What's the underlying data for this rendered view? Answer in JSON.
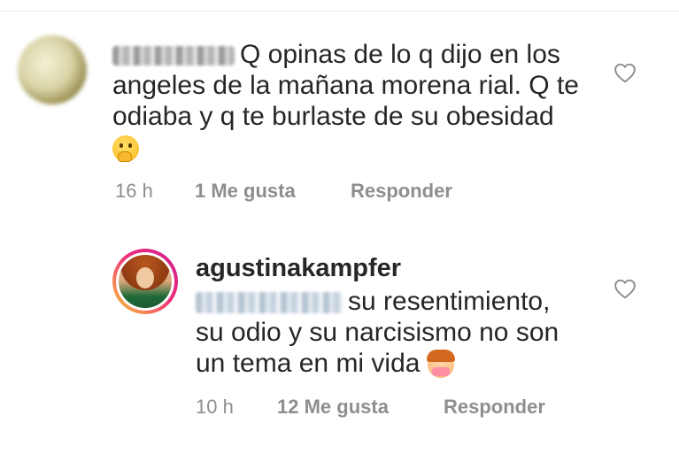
{
  "comment": {
    "text_line1": "Q opinas de lo q dijo en los",
    "text_line2": "angeles de la mañana morena rial. Q te",
    "text_line3": "odiaba y q te burlaste de su obesidad",
    "emoji": "thinking-face-emoji",
    "time": "16 h",
    "likes": "1 Me gusta",
    "reply": "Responder"
  },
  "reply": {
    "username": "agustinakampfer",
    "text_line1": "su resentimiento,",
    "text_line2": "su odio y su narcisismo no son",
    "text_line3": "un tema en mi vida",
    "emoji": "woman-gesturing-no-emoji",
    "time": "10 h",
    "likes": "12 Me gusta",
    "reply": "Responder"
  },
  "icons": {
    "like": "heart-outline-icon"
  },
  "colors": {
    "text": "#262626",
    "meta": "#8e8e8e",
    "mention_blur": "#c6d2df",
    "ring_start": "#f9ce34",
    "ring_end": "#cf1f8d"
  }
}
